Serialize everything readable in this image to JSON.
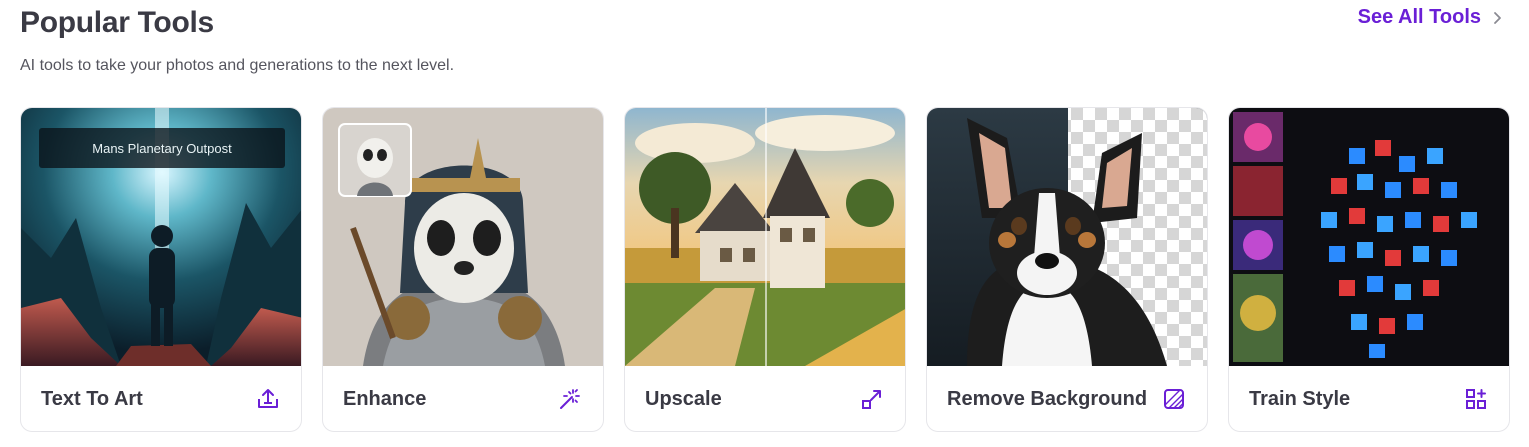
{
  "section": {
    "title": "Popular Tools",
    "subtitle": "AI tools to take your photos and generations to the next level.",
    "see_all_label": "See All Tools"
  },
  "cards": [
    {
      "label": "Text To Art",
      "overlay": "Mans Planetary Outpost",
      "icon": "upload-icon"
    },
    {
      "label": "Enhance",
      "icon": "magic-wand-icon"
    },
    {
      "label": "Upscale",
      "icon": "expand-arrow-icon"
    },
    {
      "label": "Remove Background",
      "icon": "remove-background-icon"
    },
    {
      "label": "Train Style",
      "icon": "train-style-icon"
    }
  ],
  "colors": {
    "accent": "#6a1fd6",
    "text": "#3a3a44"
  }
}
